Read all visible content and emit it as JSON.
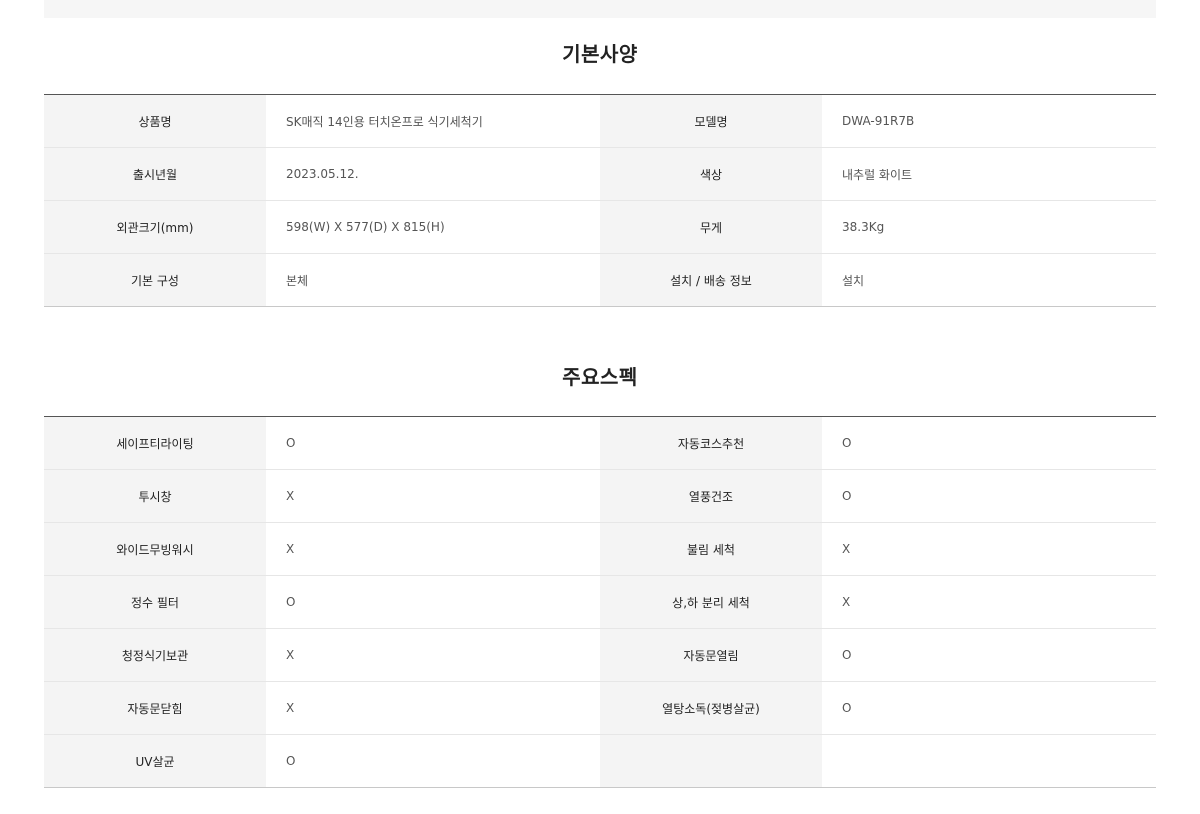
{
  "basic_spec": {
    "title": "기본사양",
    "rows": [
      {
        "label1": "상품명",
        "value1": "SK매직 14인용 터치온프로 식기세척기",
        "label2": "모델명",
        "value2": "DWA-91R7B"
      },
      {
        "label1": "출시년월",
        "value1": "2023.05.12.",
        "label2": "색상",
        "value2": "내추럴 화이트"
      },
      {
        "label1": "외관크기(mm)",
        "value1": "598(W) X 577(D) X 815(H)",
        "label2": "무게",
        "value2": "38.3Kg"
      },
      {
        "label1": "기본 구성",
        "value1": "본체",
        "label2": "설치 / 배송 정보",
        "value2": "설치"
      }
    ]
  },
  "main_spec": {
    "title": "주요스펙",
    "rows": [
      {
        "label1": "세이프티라이팅",
        "value1": "O",
        "label2": "자동코스추천",
        "value2": "O"
      },
      {
        "label1": "투시창",
        "value1": "X",
        "label2": "열풍건조",
        "value2": "O"
      },
      {
        "label1": "와이드무빙워시",
        "value1": "X",
        "label2": "불림 세척",
        "value2": "X"
      },
      {
        "label1": "정수 필터",
        "value1": "O",
        "label2": "상,하 분리 세척",
        "value2": "X"
      },
      {
        "label1": "청정식기보관",
        "value1": "X",
        "label2": "자동문열림",
        "value2": "O"
      },
      {
        "label1": "자동문닫힘",
        "value1": "X",
        "label2": "열탕소독(젖병살균)",
        "value2": "O"
      },
      {
        "label1": "UV살균",
        "value1": "O",
        "label2": "",
        "value2": ""
      }
    ]
  }
}
